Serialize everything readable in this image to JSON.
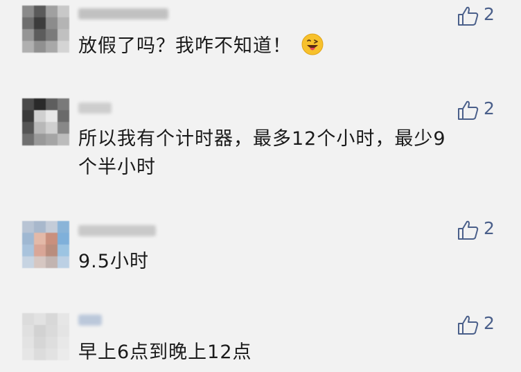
{
  "comments": [
    {
      "text": "放假了吗？我咋不知道！",
      "emoji": "grinning-tongue-wink-emoji",
      "likes": "2"
    },
    {
      "text_line1": "所以我有个计时器，最多12个小时，最少9",
      "text_line2": "个半小时",
      "likes": "2"
    },
    {
      "text": "9.5小时",
      "likes": "2"
    },
    {
      "text": "早上6点到晚上12点",
      "likes": "2"
    }
  ],
  "colors": {
    "background": "#f2f2f2",
    "text": "#1a1a1a",
    "like": "#4a5f8a"
  },
  "icons": [
    "thumbs-up-icon",
    "grinning-tongue-wink-emoji"
  ]
}
